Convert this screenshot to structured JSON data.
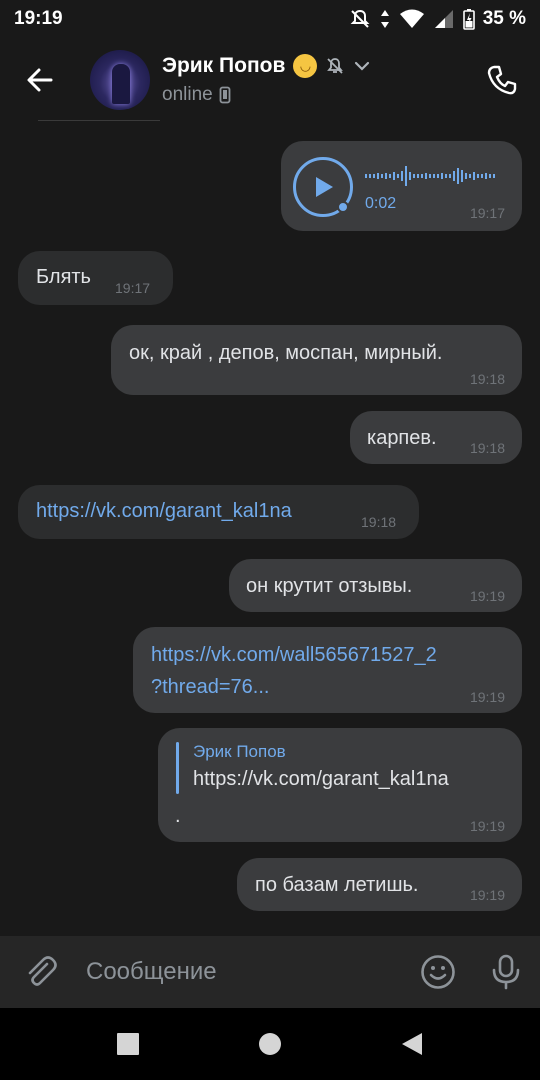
{
  "status_bar": {
    "time": "19:19",
    "battery": "35 %"
  },
  "header": {
    "name": "Эрик Попов",
    "status": "online"
  },
  "messages": [
    {
      "id": "m1",
      "dir": "out",
      "type": "voice",
      "duration": "0:02",
      "time": "19:17"
    },
    {
      "id": "m2",
      "dir": "in",
      "text": "Блять",
      "time": "19:17"
    },
    {
      "id": "m3",
      "dir": "out",
      "text": "ок, край , депов, моспан, мирный.",
      "time": "19:18"
    },
    {
      "id": "m4",
      "dir": "out",
      "text": "карпев.",
      "time": "19:18"
    },
    {
      "id": "m5",
      "dir": "in",
      "type": "link",
      "text": "https://vk.com/garant_kal1na",
      "time": "19:18"
    },
    {
      "id": "m6",
      "dir": "out",
      "text": "он крутит отзывы.",
      "time": "19:19"
    },
    {
      "id": "m7",
      "dir": "out",
      "type": "link",
      "line1": "https://vk.com/wall565671527_2",
      "line2": "?thread=76...",
      "time": "19:19"
    },
    {
      "id": "m8",
      "dir": "out",
      "type": "reply",
      "reply_author": "Эрик Попов",
      "reply_text": "https://vk.com/garant_kal1na",
      "text": ".",
      "time": "19:19"
    },
    {
      "id": "m9",
      "dir": "out",
      "text": "по базам летишь.",
      "time": "19:19"
    }
  ],
  "composer": {
    "placeholder": "Сообщение"
  },
  "icons": {
    "back": "arrow-left-icon",
    "mute": "muted-bell-icon",
    "phone": "phone-icon",
    "attach": "paperclip-icon",
    "emoji": "smile-icon",
    "mic": "microphone-icon"
  },
  "colors": {
    "accent": "#71aaeb",
    "bubble_in": "#2c2d2e",
    "bubble_out": "#3b3c3e",
    "background": "#191919"
  }
}
